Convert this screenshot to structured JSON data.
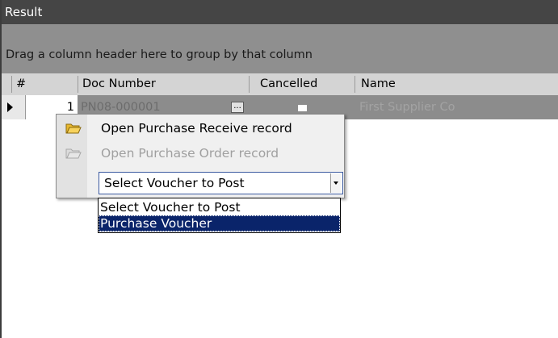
{
  "panel": {
    "title": "Result"
  },
  "grid": {
    "group_hint": "Drag a column header here to group by that column",
    "columns": [
      "#",
      "Doc Number",
      "Cancelled",
      "Name"
    ],
    "rows": [
      {
        "number": "1",
        "doc_number": "PN08-000001",
        "cancelled": false,
        "name": "First Supplier Co"
      }
    ],
    "ellipsis_label": "..."
  },
  "context_menu": {
    "items": [
      {
        "label": "Open Purchase Receive record",
        "icon": "folder-open-icon",
        "enabled": true
      },
      {
        "label": "Open Purchase Order record",
        "icon": "folder-open-icon",
        "enabled": false
      }
    ],
    "voucher_select": {
      "value": "Select Voucher to Post",
      "options": [
        "Select Voucher to Post",
        "Purchase Voucher"
      ],
      "highlighted_option": "Purchase Voucher"
    }
  },
  "colors": {
    "title_bar": "#454545",
    "group_panel": "#8f8f8f",
    "selected_row": "#8c8c8c",
    "highlight": "#0a246a"
  }
}
